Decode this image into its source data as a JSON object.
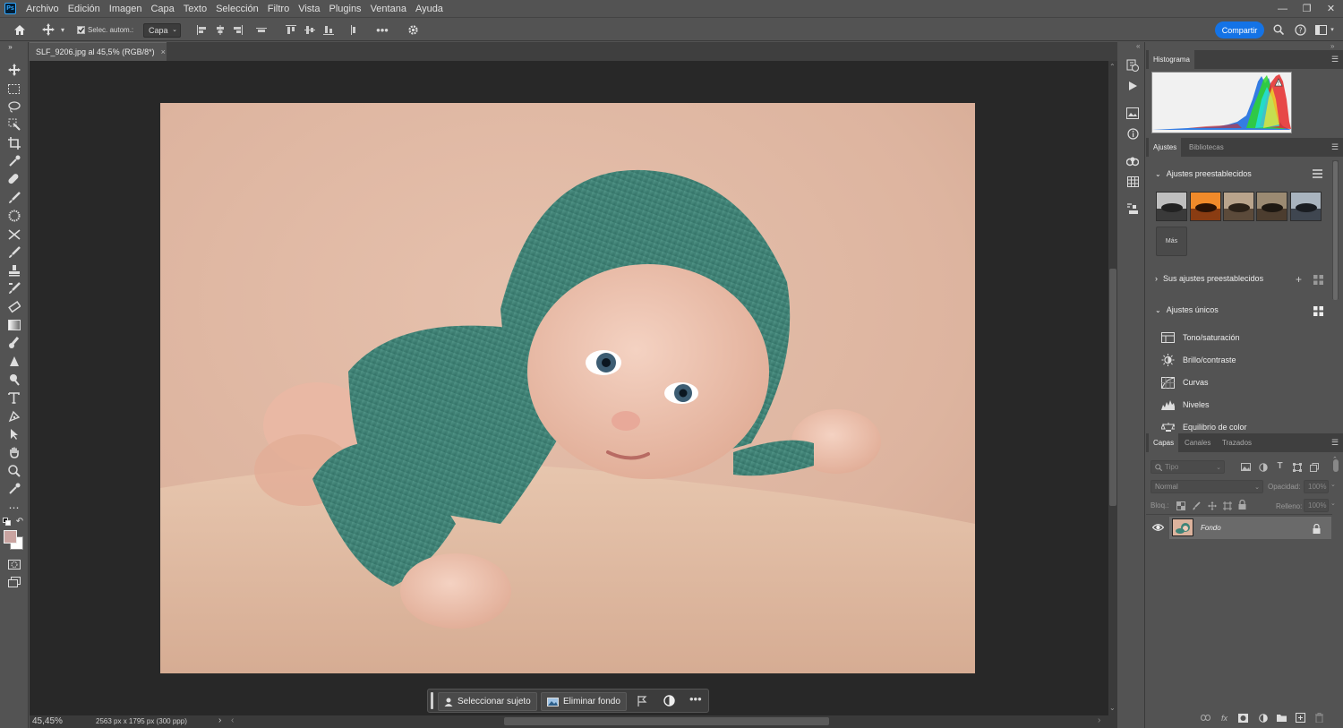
{
  "app": {
    "logo_text": "Ps"
  },
  "menu": [
    "Archivo",
    "Edición",
    "Imagen",
    "Capa",
    "Texto",
    "Selección",
    "Filtro",
    "Vista",
    "Plugins",
    "Ventana",
    "Ayuda"
  ],
  "options_bar": {
    "auto_select_label": "Selec. autom.:",
    "auto_select_checked": true,
    "target_value": "Capa",
    "share_label": "Compartir"
  },
  "document": {
    "tab_title": "SLF_9206.jpg al 45,5% (RGB/8*)",
    "zoom": "45,45%",
    "info": "2563 px x 1795 px (300 ppp)"
  },
  "context_bar": {
    "select_subject": "Seleccionar sujeto",
    "remove_background": "Eliminar fondo"
  },
  "panels": {
    "histogram_tab": "Histograma",
    "adjust_tabs": [
      "Ajustes",
      "Bibliotecas"
    ],
    "presets_header": "Ajustes preestablecidos",
    "more_label": "Más",
    "your_presets": "Sus ajustes preestablecidos",
    "single_adjustments": "Ajustes únicos",
    "adjustments": [
      {
        "label": "Tono/saturación",
        "icon": "hue-saturation-icon"
      },
      {
        "label": "Brillo/contraste",
        "icon": "brightness-contrast-icon"
      },
      {
        "label": "Curvas",
        "icon": "curves-icon"
      },
      {
        "label": "Niveles",
        "icon": "levels-icon"
      },
      {
        "label": "Equilibrio de color",
        "icon": "color-balance-icon"
      }
    ],
    "layer_tabs": [
      "Capas",
      "Canales",
      "Trazados"
    ],
    "filter_placeholder": "Tipo",
    "blend_mode": "Normal",
    "opacity_label": "Opacidad:",
    "opacity_value": "100%",
    "lock_label": "Bloq.:",
    "fill_label": "Relleno:",
    "fill_value": "100%",
    "layer_name": "Fondo"
  },
  "colors": {
    "foreground": "#c9a3a0",
    "background": "#ffffff",
    "accent": "#1473e6"
  }
}
